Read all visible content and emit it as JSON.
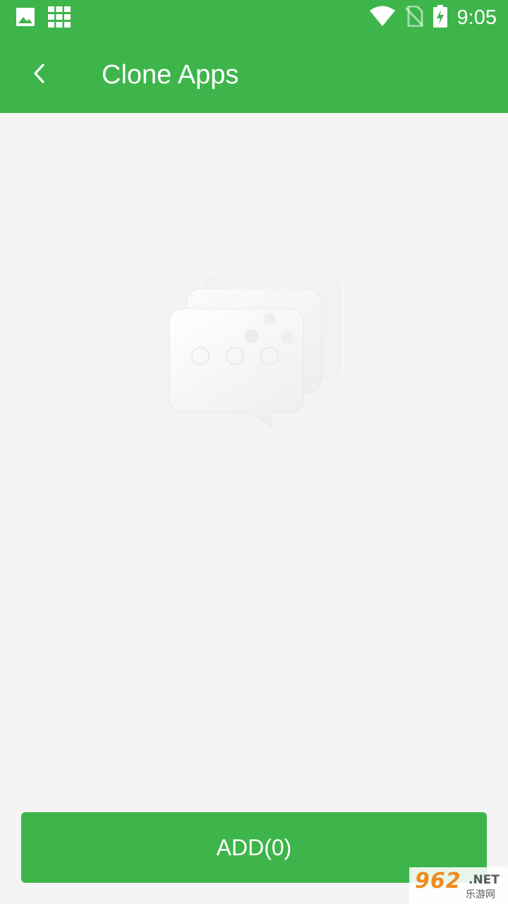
{
  "status_bar": {
    "time": "9:05",
    "icons": [
      "image-icon",
      "grid-apps-icon",
      "wifi-icon",
      "no-sim-icon",
      "battery-charging-icon"
    ]
  },
  "toolbar": {
    "back_icon": "back-arrow-icon",
    "title": "Clone Apps"
  },
  "main": {
    "empty_state_icon": "chat-bubbles-icon"
  },
  "footer": {
    "add_label": "ADD(0)"
  },
  "watermark": {
    "logo": "962",
    "suffix": ".NET",
    "subtitle": "乐游网"
  },
  "colors": {
    "brand_green": "#3db54a",
    "background": "#f4f4f4",
    "on_brand": "#ffffff"
  }
}
